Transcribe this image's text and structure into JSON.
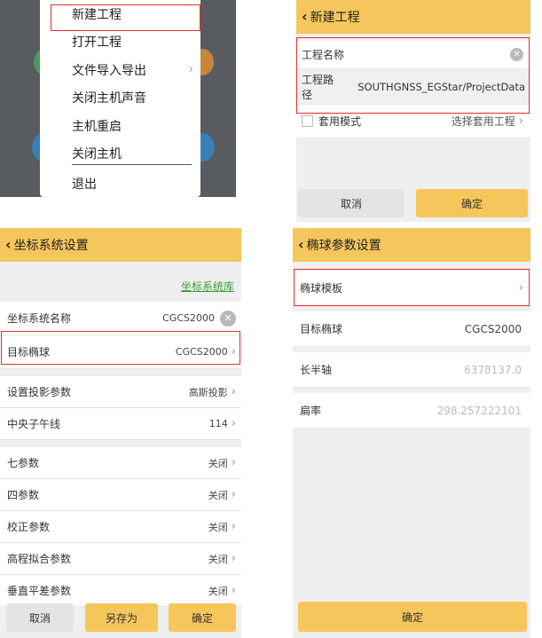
{
  "menu": {
    "items": [
      {
        "label": "新建工程",
        "submenu": false
      },
      {
        "label": "打开工程",
        "submenu": false
      },
      {
        "label": "文件导入导出",
        "submenu": true
      },
      {
        "label": "关闭主机声音",
        "submenu": false
      },
      {
        "label": "主机重启",
        "submenu": false
      },
      {
        "label": "关闭主机",
        "submenu": false
      },
      {
        "label": "退出",
        "submenu": false
      }
    ],
    "chevron": "›"
  },
  "new_project": {
    "back": "‹",
    "title": "新建工程",
    "name_label": "工程名称",
    "name_value": "",
    "path_label": "工程路径",
    "path_value": "SOUTHGNSS_EGStar/ProjectData",
    "template_mode_label": "套用模式",
    "template_select_label": "选择套用工程",
    "chevron": "›",
    "cancel": "取消",
    "confirm": "确定"
  },
  "coord": {
    "back": "‹",
    "title": "坐标系统设置",
    "library_link": "坐标系统库",
    "rows": [
      {
        "label": "坐标系统名称",
        "value": "CGCS2000",
        "clearable": true
      },
      {
        "label": "目标椭球",
        "value": "CGCS2000",
        "chevron": true
      },
      {
        "label": "设置投影参数",
        "value": "高斯投影",
        "chevron": true
      },
      {
        "label": "中央子午线",
        "value": "114",
        "chevron": true
      },
      {
        "label": "七参数",
        "value": "关闭",
        "chevron": true
      },
      {
        "label": "四参数",
        "value": "关闭",
        "chevron": true
      },
      {
        "label": "校正参数",
        "value": "关闭",
        "chevron": true
      },
      {
        "label": "高程拟合参数",
        "value": "关闭",
        "chevron": true
      },
      {
        "label": "垂直平差参数",
        "value": "关闭",
        "chevron": true
      }
    ],
    "chevron": "›",
    "cancel": "取消",
    "save_as": "另存为",
    "confirm": "确定"
  },
  "ellipsoid": {
    "back": "‹",
    "title": "椭球参数设置",
    "template_label": "椭球模板",
    "chevron": "›",
    "rows": [
      {
        "label": "目标椭球",
        "value": "CGCS2000",
        "muted": false
      },
      {
        "label": "长半轴",
        "value": "6378137.0",
        "muted": true
      },
      {
        "label": "扁率",
        "value": "298.257222101",
        "muted": true
      }
    ],
    "confirm": "确定"
  },
  "colors": {
    "accent": "#f5c65c",
    "highlight": "#e0302e",
    "link": "#3a9b3a"
  }
}
